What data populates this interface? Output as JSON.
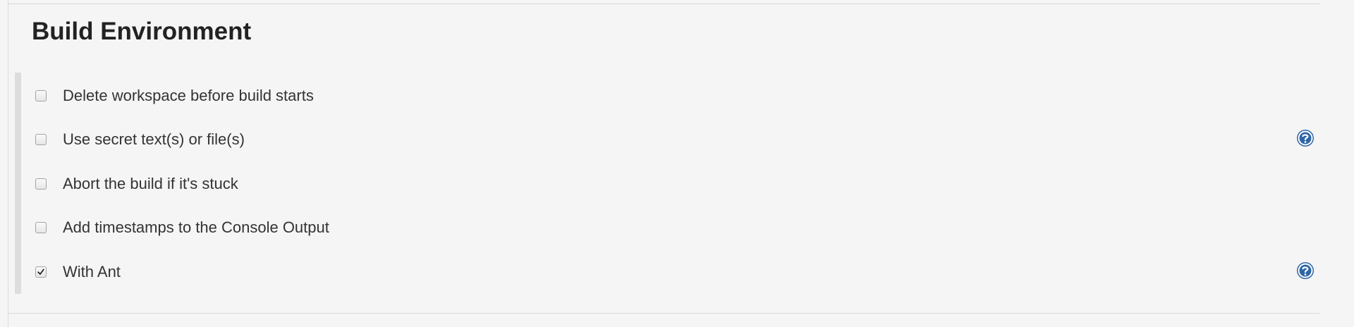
{
  "section": {
    "title": "Build Environment"
  },
  "options": [
    {
      "label": "Delete workspace before build starts",
      "checked": false
    },
    {
      "label": "Use secret text(s) or file(s)",
      "checked": false,
      "help_icon": "help-icon"
    },
    {
      "label": "Abort the build if it's stuck",
      "checked": false
    },
    {
      "label": "Add timestamps to the Console Output",
      "checked": false
    },
    {
      "label": "With Ant",
      "checked": true,
      "help_icon": "help-icon"
    }
  ],
  "colors": {
    "background": "#f5f5f5",
    "title_text": "#222222",
    "label_text": "#333333",
    "help_icon": "#2f66a6"
  }
}
